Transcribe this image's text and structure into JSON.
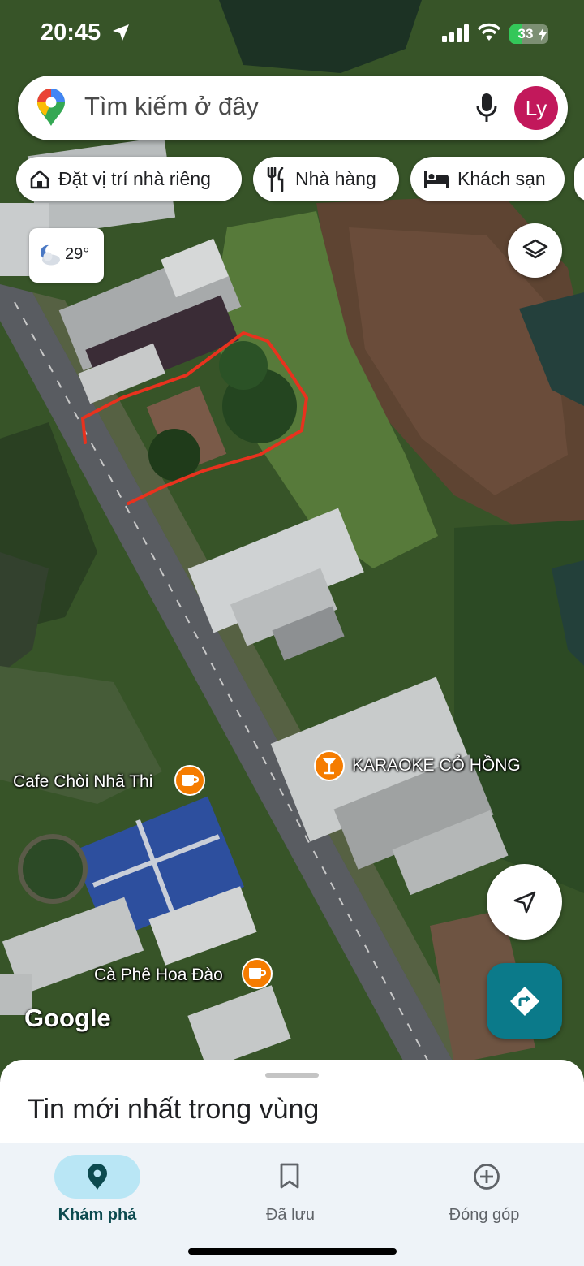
{
  "status_bar": {
    "time": "20:45",
    "battery": "33",
    "battery_level": 0.33
  },
  "search": {
    "placeholder": "Tìm kiếm ở đây",
    "avatar_letter": "Ly"
  },
  "chips": [
    {
      "label": "Đặt vị trí nhà riêng",
      "icon": "home-icon"
    },
    {
      "label": "Nhà hàng",
      "icon": "restaurant-icon"
    },
    {
      "label": "Khách sạn",
      "icon": "hotel-icon"
    }
  ],
  "weather": {
    "temperature": "29°",
    "icon": "moon-cloud-icon"
  },
  "map_labels": {
    "karaoke": "KARAOKE CỎ HỒNG",
    "cafe_choi": "Cafe Chòi Nhã Thi",
    "ca_phe_hoa_dao": "Cà Phê Hoa Đào",
    "google": "Google"
  },
  "sheet": {
    "title": "Tin mới nhất trong vùng"
  },
  "nav": {
    "items": [
      {
        "label": "Khám phá",
        "icon": "explore-pin-icon",
        "active": true
      },
      {
        "label": "Đã lưu",
        "icon": "bookmark-icon",
        "active": false
      },
      {
        "label": "Đóng góp",
        "icon": "add-circle-icon",
        "active": false
      }
    ]
  },
  "colors": {
    "accent": "#0b7a8a",
    "avatar": "#c2185b",
    "poi": "#f57c00",
    "annotation": "#e8321e",
    "nav_active_pill": "#b9e6f5"
  }
}
